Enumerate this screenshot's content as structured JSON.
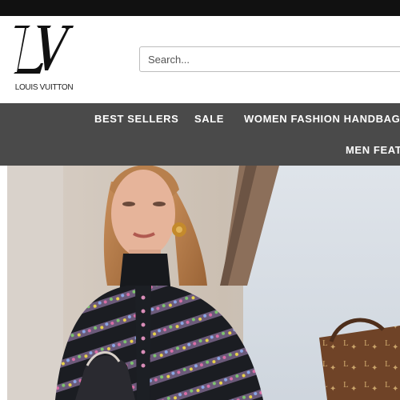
{
  "brand": {
    "name": "LOUIS VUITTON",
    "monogram": "LV"
  },
  "search": {
    "placeholder": "Search..."
  },
  "nav": {
    "items": [
      {
        "label": "BEST SELLERS"
      },
      {
        "label": "SALE"
      },
      {
        "label": "WOMEN FASHION HANDBAGS"
      },
      {
        "label": "MEN FEAT"
      }
    ]
  },
  "hero": {
    "image": "model-with-patterned-sweater-and-monogram-bag"
  },
  "colors": {
    "topbar": "#111111",
    "nav_bg": "#4a4a4a",
    "nav_text": "#ffffff"
  }
}
